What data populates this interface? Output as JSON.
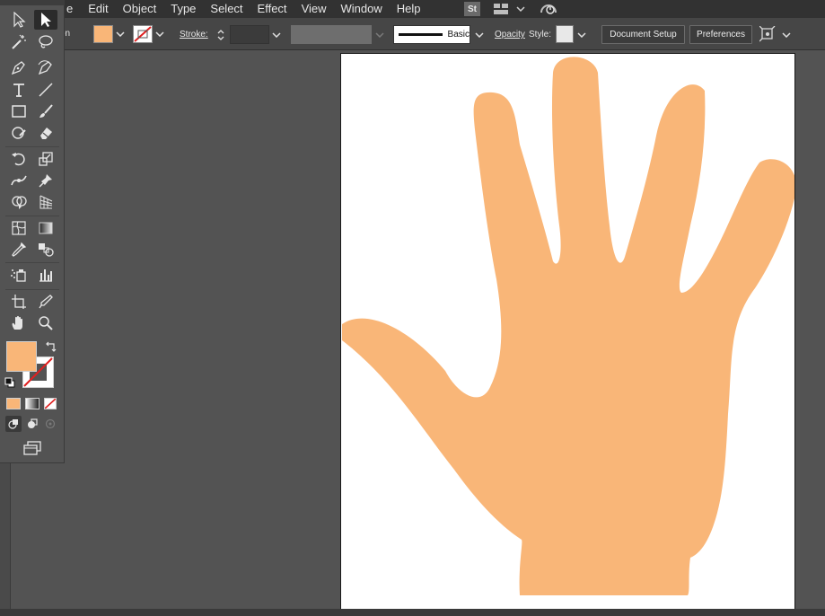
{
  "menu": {
    "items": [
      "e",
      "Edit",
      "Object",
      "Type",
      "Select",
      "Effect",
      "View",
      "Window",
      "Help"
    ],
    "stock_label": "St"
  },
  "control_bar": {
    "partial_label": "on",
    "stroke_label": "Stroke:",
    "brush_label": "Basic",
    "opacity_label": "Opacity",
    "style_label": "Style:",
    "document_setup_label": "Document Setup",
    "preferences_label": "Preferences"
  },
  "colors": {
    "fill": "#F9B678",
    "canvas_bg": "#535353",
    "panel_bg": "#464646",
    "menubar_bg": "#323232",
    "artboard_bg": "#FFFFFF",
    "stroke_none": "#E02020"
  },
  "tools": [
    "selection-tool",
    "direct-selection-tool",
    "magic-wand-tool",
    "lasso-tool",
    "pen-tool",
    "curvature-tool",
    "type-tool",
    "line-segment-tool",
    "rectangle-tool",
    "paintbrush-tool",
    "shaper-tool",
    "eraser-tool",
    "rotate-tool",
    "scale-tool",
    "width-tool",
    "puppet-warp-tool",
    "shape-builder-tool",
    "perspective-grid-tool",
    "mesh-tool",
    "gradient-tool",
    "eyedropper-tool",
    "blend-tool",
    "symbol-sprayer-tool",
    "column-graph-tool",
    "artboard-tool",
    "slice-tool",
    "hand-tool",
    "zoom-tool"
  ],
  "artwork": {
    "shape": "hand",
    "fill": "#F9B678"
  }
}
